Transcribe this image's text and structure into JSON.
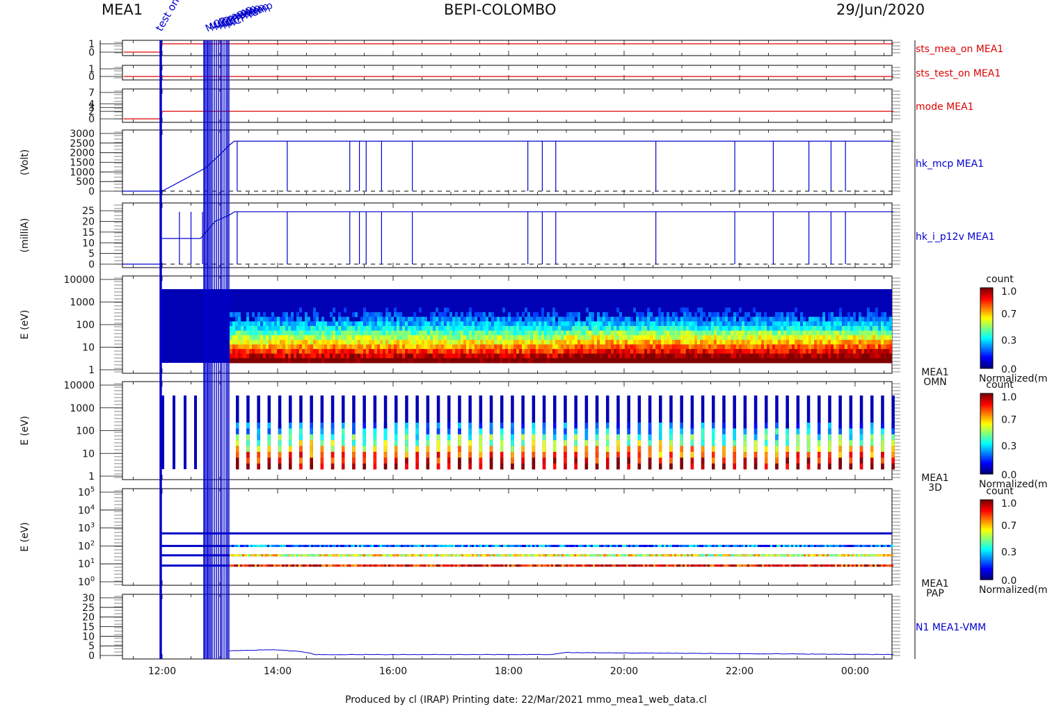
{
  "header": {
    "left": "MEA1",
    "center": "BEPI-COLOMBO",
    "right": "29/Jun/2020"
  },
  "footer": "Produced by cl (IRAP)   Printing date: 22/Mar/2021   mmo_mea1_web_data.cl",
  "colors": {
    "red": "#dd0000",
    "blue": "#0000cc",
    "axis": "#000000"
  },
  "chart_data": [
    {
      "type": "line",
      "name": "sts_mea_on MEA1",
      "yticks": [
        "1",
        "0"
      ],
      "ylim": [
        0,
        1
      ],
      "series": [
        {
          "name": "sts_mea_on MEA1",
          "x": [
            "11:20",
            "11:59",
            "12:00",
            "00:40"
          ],
          "values": [
            0,
            0,
            1,
            1
          ]
        }
      ]
    },
    {
      "type": "line",
      "name": "sts_test_on MEA1",
      "yticks": [
        "1",
        "0"
      ],
      "ylim": [
        0,
        1
      ],
      "series": [
        {
          "name": "sts_test_on MEA1",
          "x": [
            "11:20",
            "00:40"
          ],
          "values": [
            0,
            0
          ]
        }
      ]
    },
    {
      "type": "line",
      "name": "mode MEA1",
      "yticks": [
        "7",
        "4",
        "3",
        "2",
        "0"
      ],
      "ylim": [
        0,
        7
      ],
      "series": [
        {
          "name": "mode MEA1",
          "x": [
            "11:20",
            "11:59",
            "12:00",
            "00:40"
          ],
          "values": [
            0,
            0,
            2,
            2
          ]
        }
      ]
    },
    {
      "type": "line",
      "name": "hk_mcp MEA1",
      "ylabel": "(Volt)",
      "yticks": [
        "3000",
        "2500",
        "2000",
        "1500",
        "1000",
        "500",
        "0"
      ],
      "ylim": [
        0,
        3000
      ],
      "series": [
        {
          "name": "hk_mcp MEA1",
          "x": [
            "12:00",
            "12:45",
            "13:00",
            "13:10",
            "13:15",
            "00:40"
          ],
          "values": [
            0,
            1200,
            1900,
            2400,
            2600,
            2600
          ]
        }
      ],
      "dropouts": [
        "13:18",
        "14:10",
        "15:15",
        "15:25",
        "15:32",
        "15:48",
        "16:20",
        "18:20",
        "18:35",
        "18:49",
        "20:33",
        "21:55",
        "22:35",
        "23:12",
        "23:35",
        "23:50"
      ]
    },
    {
      "type": "line",
      "name": "hk_i_p12v MEA1",
      "ylabel": "(milliA)",
      "yticks": [
        "25",
        "20",
        "15",
        "10",
        "5",
        "0"
      ],
      "ylim": [
        0,
        27
      ],
      "series": [
        {
          "name": "hk_i_p12v MEA1",
          "x": [
            "12:00",
            "12:40",
            "12:55",
            "13:10",
            "13:15",
            "00:40"
          ],
          "values": [
            12,
            12,
            20,
            23,
            24.5,
            24.5
          ]
        }
      ],
      "dropouts": [
        "12:18",
        "12:30",
        "12:42",
        "13:18",
        "14:10",
        "15:15",
        "15:25",
        "15:32",
        "15:48",
        "16:20",
        "18:20",
        "18:35",
        "18:49",
        "20:33",
        "21:55",
        "22:35",
        "23:12",
        "23:35",
        "23:50"
      ]
    },
    {
      "type": "heatmap",
      "name": "MEA1 OMN",
      "ylabel": "E (eV)",
      "yticks": [
        "10000",
        "1000",
        "100",
        "10",
        "1"
      ],
      "ylim": [
        1,
        10000
      ],
      "yscale": "log",
      "colorbar": {
        "title": "count",
        "ticks": [
          "1.0",
          "0.7",
          "0.3",
          "0.0"
        ],
        "label": "Normalized(m"
      },
      "right_label": [
        "MEA1",
        "OMN"
      ]
    },
    {
      "type": "heatmap",
      "name": "MEA1 3D",
      "ylabel": "E (eV)",
      "yticks": [
        "10000",
        "1000",
        "100",
        "10",
        "1"
      ],
      "ylim": [
        1,
        10000
      ],
      "yscale": "log",
      "colorbar": {
        "title": "count",
        "ticks": [
          "1.0",
          "0.7",
          "0.3",
          "0.0"
        ],
        "label": "Normalized(m"
      },
      "right_label": [
        "MEA1",
        "3D"
      ]
    },
    {
      "type": "heatmap",
      "name": "MEA1 PAP",
      "ylabel": "E (eV)",
      "ytick_exponents": [
        "5",
        "4",
        "3",
        "2",
        "1",
        "0"
      ],
      "ylim": [
        1,
        100000
      ],
      "yscale": "log",
      "levels": [
        500,
        100,
        30,
        8
      ],
      "colorbar": {
        "title": "count",
        "ticks": [
          "1.0",
          "0.7",
          "0.3",
          "0.0"
        ],
        "label": "Normalized(m"
      },
      "right_label": [
        "MEA1",
        "PAP"
      ]
    },
    {
      "type": "line",
      "name": "N1 MEA1-VMM",
      "yticks": [
        "30",
        "25",
        "20",
        "15",
        "10",
        "5",
        "0"
      ],
      "ylim": [
        0,
        30
      ],
      "series": [
        {
          "name": "N1 MEA1-VMM",
          "x": [
            "13:10",
            "14:00",
            "14:25",
            "14:40",
            "18:45",
            "19:00",
            "00:40"
          ],
          "values": [
            2.5,
            3,
            2,
            0.5,
            0.5,
            1.5,
            0.5
          ]
        }
      ]
    }
  ],
  "xaxis": {
    "ticks": [
      "12:00",
      "14:00",
      "16:00",
      "18:00",
      "20:00",
      "22:00",
      "00:00"
    ]
  },
  "annotations": [
    "test on",
    "MCP ramp"
  ]
}
